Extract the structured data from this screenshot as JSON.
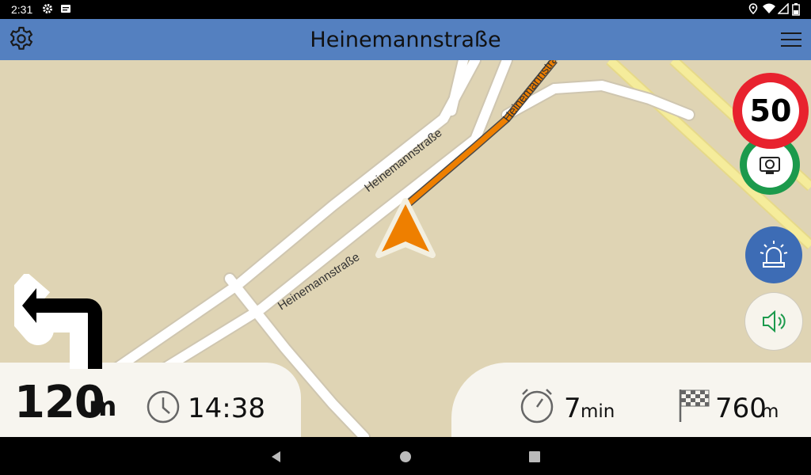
{
  "status_bar": {
    "time": "2:31"
  },
  "header": {
    "title": "Heinemannstraße"
  },
  "map": {
    "street_labels": [
      "Heinemannstraße",
      "Heinemannstraße",
      "Heinemannstraße"
    ]
  },
  "speed_limit": {
    "value": "50"
  },
  "maneuver": {
    "direction": "turn-left-icon",
    "distance_value": "120",
    "distance_unit": "m"
  },
  "trip": {
    "eta": "14:38",
    "duration_value": "7",
    "duration_unit": "min",
    "remaining_value": "760",
    "remaining_unit": "m"
  },
  "colors": {
    "header_bg": "#5480c0",
    "route": "#ee7f00",
    "speed_ring": "#e8222e",
    "camera_ring": "#1c9a4c",
    "alarm_button": "#3d6cb5",
    "map_bg": "#dfd4b4"
  }
}
